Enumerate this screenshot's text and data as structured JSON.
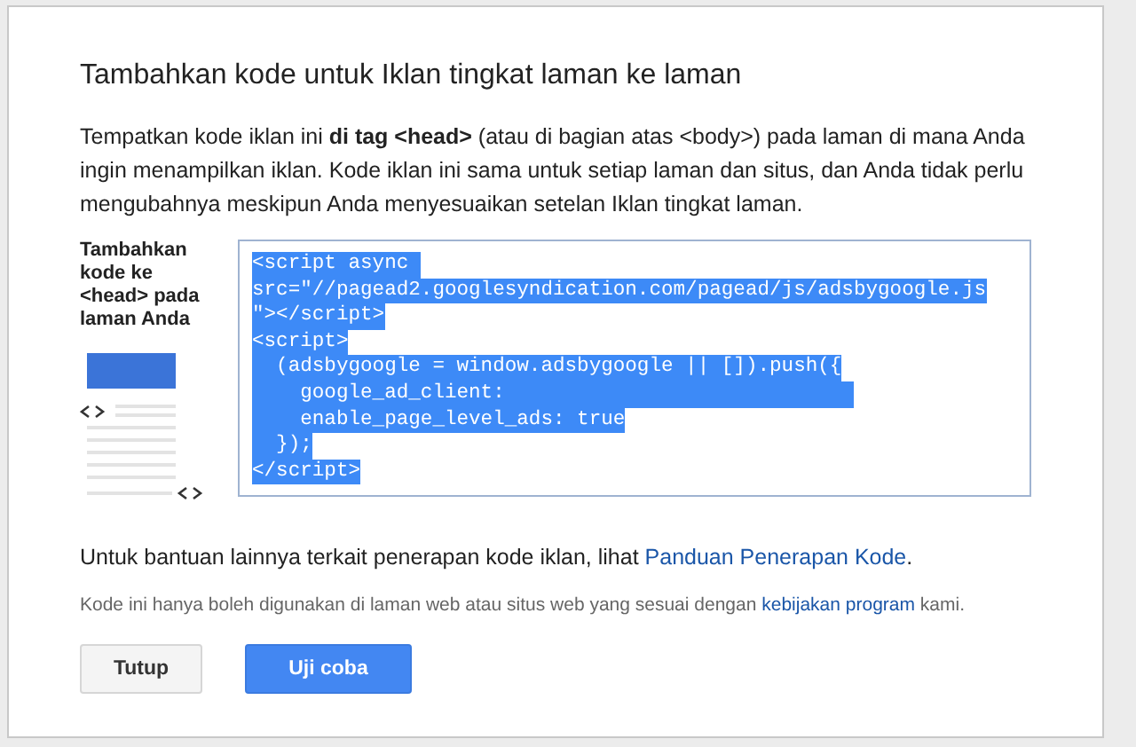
{
  "dialog": {
    "title": "Tambahkan kode untuk Iklan tingkat laman ke laman",
    "intro": "Tempatkan kode iklan ini **di tag <head>** (atau di bagian atas <body>) pada laman di mana Anda ingin menampilkan iklan. Kode iklan ini sama untuk setiap laman dan situs, dan Anda tidak perlu mengubahnya meskipun Anda menyesuaikan setelan Iklan tingkat laman.",
    "side_label": "Tambahkan kode ke <head> pada laman Anda",
    "code_lines": [
      {
        "text": "<script async ",
        "selected": true
      },
      {
        "text": "src=\"//pagead2.googlesyndication.com/pagead/js/adsbygoogle.js",
        "selected": true
      },
      {
        "text": "\"></script>",
        "selected": true
      },
      {
        "text": "<script>",
        "selected": true
      },
      {
        "text": "  (adsbygoogle = window.adsbygoogle || []).push({",
        "selected": true
      },
      {
        "text": "    google_ad_client:                             ",
        "selected": true
      },
      {
        "text": "    enable_page_level_ads: true",
        "selected": true
      },
      {
        "text": "  });",
        "selected": true
      },
      {
        "text": "</script>",
        "selected": true
      }
    ],
    "help": {
      "text": "Untuk bantuan lainnya terkait penerapan kode iklan, lihat ",
      "link": "Panduan Penerapan Kode",
      "end": "."
    },
    "note": {
      "text": "Kode ini hanya boleh digunakan di laman web atau situs web yang sesuai dengan ",
      "link": "kebijakan program",
      "end": " kami."
    },
    "buttons": [
      {
        "label": "Tutup",
        "kind": "secondary"
      },
      {
        "label": "Uji coba",
        "kind": "primary"
      }
    ]
  }
}
